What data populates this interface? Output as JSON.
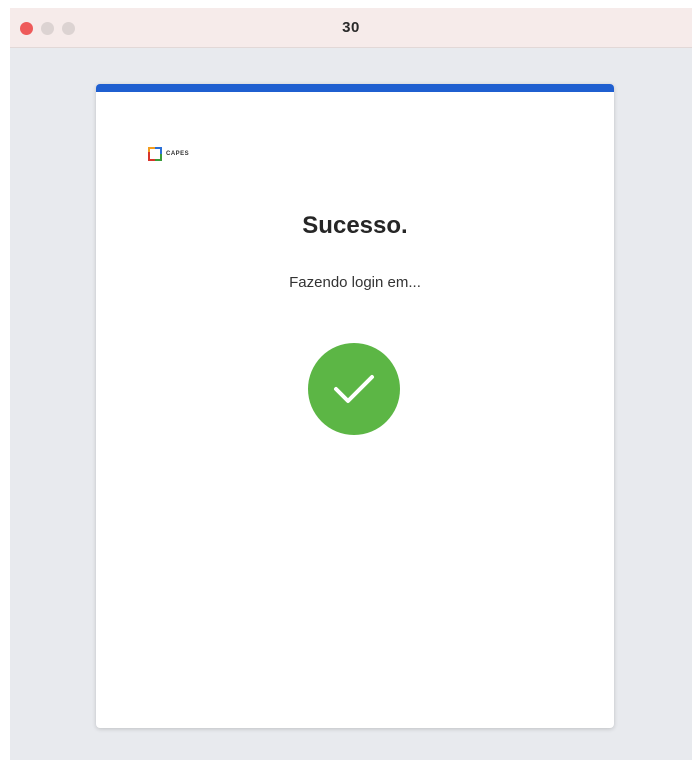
{
  "window": {
    "title": "30"
  },
  "card": {
    "logo_text": "CAPES",
    "heading": "Sucesso.",
    "message": "Fazendo login em..."
  },
  "icons": {
    "success": "checkmark-icon",
    "logo": "capes-logo-icon"
  },
  "colors": {
    "accent": "#1f5fd0",
    "success": "#5cb645",
    "close_button": "#ee5a5a"
  }
}
